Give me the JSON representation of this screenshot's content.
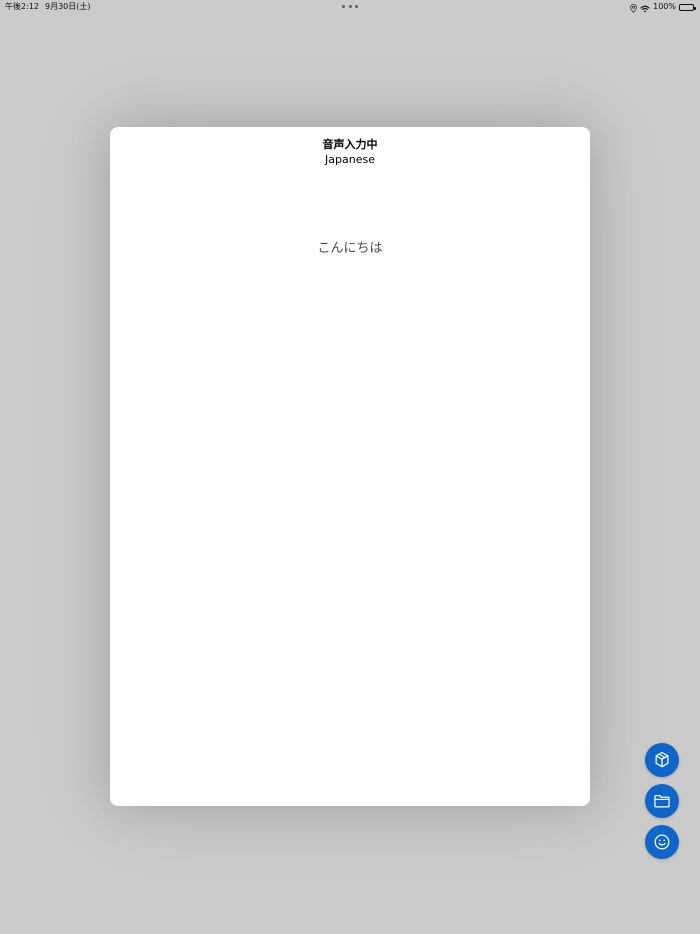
{
  "status_bar": {
    "time": "午後2:12",
    "date": "9月30日(土)",
    "battery_percent": "100%",
    "icons": [
      "multitask-dots-icon",
      "location-icon",
      "wifi-icon",
      "battery-icon"
    ]
  },
  "sheet": {
    "title": "音声入力中",
    "subtitle": "Japanese",
    "transcript": "こんにちは"
  },
  "actions": [
    {
      "icon": "box-icon"
    },
    {
      "icon": "folder-icon"
    },
    {
      "icon": "smiley-icon"
    }
  ],
  "colors": {
    "background": "#cbcbcb",
    "sheet": "#ffffff",
    "fab": "#0f65c8",
    "transcript_text": "#4c4c4c"
  }
}
